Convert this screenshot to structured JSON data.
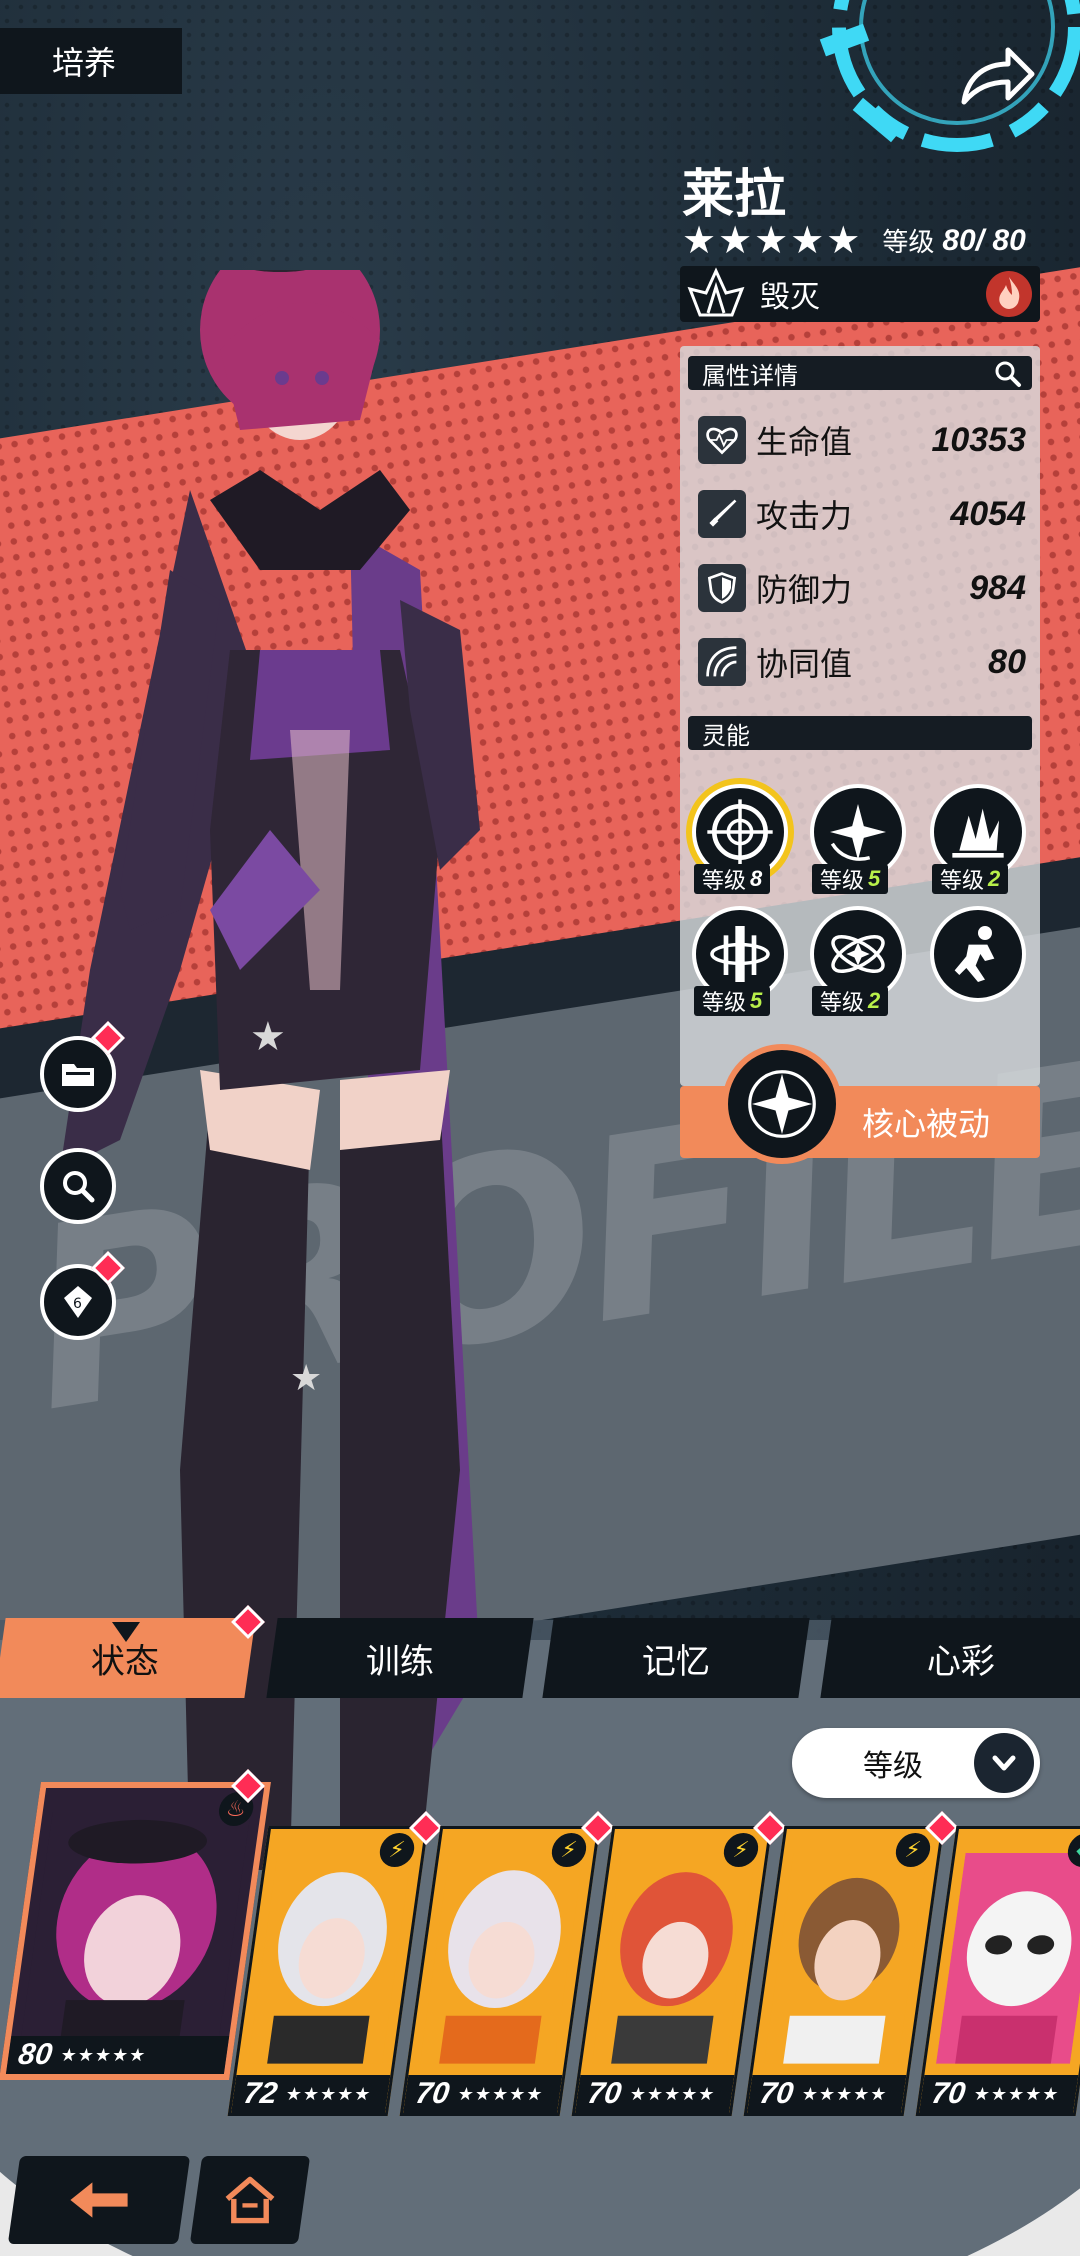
{
  "header": {
    "title": "培养"
  },
  "character": {
    "name": "莱拉",
    "stars": "★★★★★",
    "level_label": "等级",
    "level_value": "80/ 80",
    "faction": "毁灭"
  },
  "attributes": {
    "header": "属性详情",
    "stats": [
      {
        "label": "生命值",
        "value": "10353",
        "icon": "heart-icon"
      },
      {
        "label": "攻击力",
        "value": "4054",
        "icon": "sword-icon"
      },
      {
        "label": "防御力",
        "value": "984",
        "icon": "shield-icon"
      },
      {
        "label": "协同值",
        "value": "80",
        "icon": "synergy-icon"
      }
    ]
  },
  "skills": {
    "header": "灵能",
    "level_label": "等级",
    "items": [
      {
        "level": "8"
      },
      {
        "level": "5"
      },
      {
        "level": "2"
      },
      {
        "level": "5"
      },
      {
        "level": "2"
      },
      {
        "level": ""
      }
    ]
  },
  "core_passive": {
    "label": "核心被动"
  },
  "tabs": [
    {
      "label": "状态",
      "active": true
    },
    {
      "label": "训练"
    },
    {
      "label": "记忆"
    },
    {
      "label": "心彩"
    }
  ],
  "sort": {
    "label": "等级"
  },
  "background_text": "PROFILE",
  "roster": [
    {
      "level": "80",
      "stars": "★★★★★"
    },
    {
      "level": "72",
      "stars": "★★★★★"
    },
    {
      "level": "70",
      "stars": "★★★★★"
    },
    {
      "level": "70",
      "stars": "★★★★★"
    },
    {
      "level": "70",
      "stars": "★★★★★"
    },
    {
      "level": "70",
      "stars": "★★★★★"
    }
  ],
  "colors": {
    "accent": "#f28a5a",
    "panel_dark": "#0f161c",
    "skill_level": "#b8f04a",
    "notification": "#ff2d55",
    "ring_cyan": "#3fd9f5"
  }
}
